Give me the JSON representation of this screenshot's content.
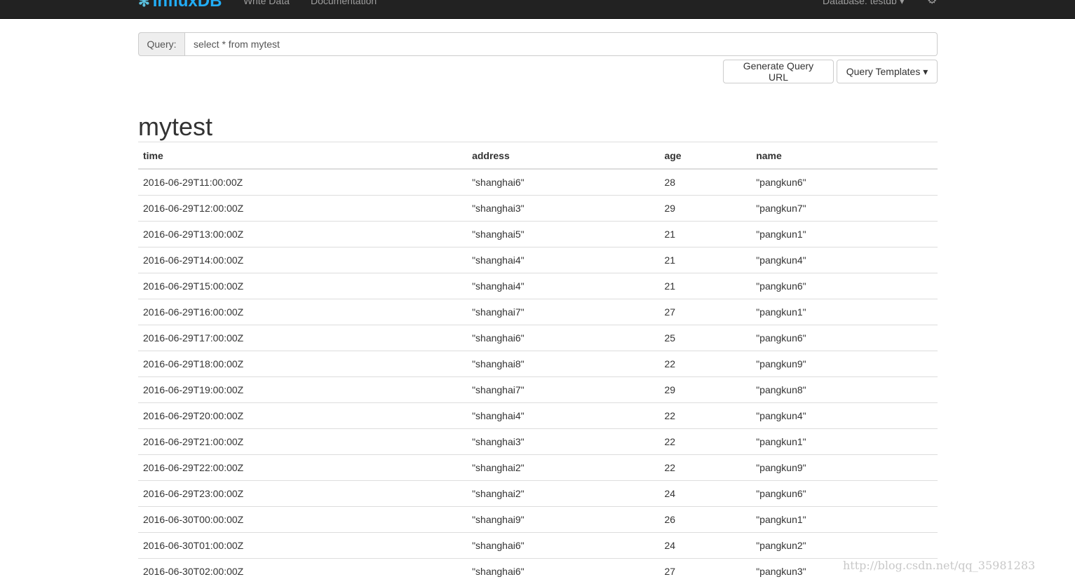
{
  "navbar": {
    "brand": "InfluxDB",
    "links": [
      "Write Data",
      "Documentation"
    ],
    "database": "Database: testdb"
  },
  "query": {
    "label": "Query:",
    "value": "select * from mytest"
  },
  "buttons": {
    "generate": "Generate Query URL",
    "templates": "Query Templates"
  },
  "result": {
    "title": "mytest",
    "columns": [
      "time",
      "address",
      "age",
      "name"
    ],
    "rows": [
      [
        "2016-06-29T11:00:00Z",
        "\"shanghai6\"",
        "28",
        "\"pangkun6\""
      ],
      [
        "2016-06-29T12:00:00Z",
        "\"shanghai3\"",
        "29",
        "\"pangkun7\""
      ],
      [
        "2016-06-29T13:00:00Z",
        "\"shanghai5\"",
        "21",
        "\"pangkun1\""
      ],
      [
        "2016-06-29T14:00:00Z",
        "\"shanghai4\"",
        "21",
        "\"pangkun4\""
      ],
      [
        "2016-06-29T15:00:00Z",
        "\"shanghai4\"",
        "21",
        "\"pangkun6\""
      ],
      [
        "2016-06-29T16:00:00Z",
        "\"shanghai7\"",
        "27",
        "\"pangkun1\""
      ],
      [
        "2016-06-29T17:00:00Z",
        "\"shanghai6\"",
        "25",
        "\"pangkun6\""
      ],
      [
        "2016-06-29T18:00:00Z",
        "\"shanghai8\"",
        "22",
        "\"pangkun9\""
      ],
      [
        "2016-06-29T19:00:00Z",
        "\"shanghai7\"",
        "29",
        "\"pangkun8\""
      ],
      [
        "2016-06-29T20:00:00Z",
        "\"shanghai4\"",
        "22",
        "\"pangkun4\""
      ],
      [
        "2016-06-29T21:00:00Z",
        "\"shanghai3\"",
        "22",
        "\"pangkun1\""
      ],
      [
        "2016-06-29T22:00:00Z",
        "\"shanghai2\"",
        "22",
        "\"pangkun9\""
      ],
      [
        "2016-06-29T23:00:00Z",
        "\"shanghai2\"",
        "24",
        "\"pangkun6\""
      ],
      [
        "2016-06-30T00:00:00Z",
        "\"shanghai9\"",
        "26",
        "\"pangkun1\""
      ],
      [
        "2016-06-30T01:00:00Z",
        "\"shanghai6\"",
        "24",
        "\"pangkun2\""
      ],
      [
        "2016-06-30T02:00:00Z",
        "\"shanghai6\"",
        "27",
        "\"pangkun3\""
      ]
    ]
  },
  "watermark": "http://blog.csdn.net/qq_35981283"
}
